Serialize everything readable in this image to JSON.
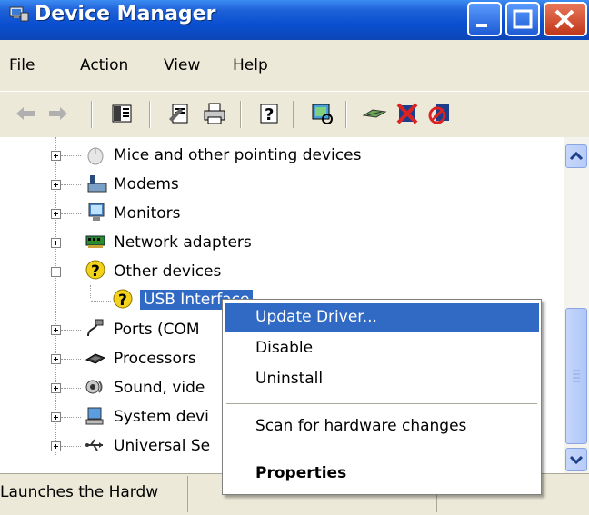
{
  "window": {
    "title": "Device Manager"
  },
  "menubar": {
    "items": [
      "File",
      "Action",
      "View",
      "Help"
    ]
  },
  "toolbar": {
    "buttons": [
      "back-icon",
      "forward-icon",
      "show-hide-tree-icon",
      "properties-icon",
      "print-icon",
      "help-icon",
      "scan-hardware-icon",
      "update-driver-icon",
      "uninstall-icon",
      "disable-icon"
    ]
  },
  "tree": {
    "items": [
      {
        "label": "Mice and other pointing devices",
        "icon": "mouse-icon",
        "expanded": false
      },
      {
        "label": "Modems",
        "icon": "modem-icon",
        "expanded": false
      },
      {
        "label": "Monitors",
        "icon": "monitor-icon",
        "expanded": false
      },
      {
        "label": "Network adapters",
        "icon": "network-adapter-icon",
        "expanded": false
      },
      {
        "label": "Other devices",
        "icon": "unknown-device-icon",
        "expanded": true
      },
      {
        "label": "USB Interface",
        "icon": "unknown-device-icon",
        "child": true,
        "selected": true
      },
      {
        "label": "Ports (COM",
        "icon": "port-icon",
        "expanded": false
      },
      {
        "label": "Processors",
        "icon": "processor-icon",
        "expanded": false
      },
      {
        "label": "Sound, vide",
        "icon": "sound-icon",
        "expanded": false
      },
      {
        "label": "System devi",
        "icon": "system-device-icon",
        "expanded": false
      },
      {
        "label": "Universal Se",
        "icon": "usb-icon",
        "expanded": false
      }
    ]
  },
  "context_menu": {
    "items": [
      {
        "label": "Update Driver...",
        "highlighted": true
      },
      {
        "label": "Disable"
      },
      {
        "label": "Uninstall"
      },
      {
        "separator": true
      },
      {
        "label": "Scan for hardware changes"
      },
      {
        "separator": true
      },
      {
        "label": "Properties",
        "bold": true
      }
    ]
  },
  "statusbar": {
    "text": "Launches the Hardw"
  },
  "colors": {
    "titlebar": "#0a4fd0",
    "selection": "#316ac5",
    "close_button": "#c1381a"
  }
}
